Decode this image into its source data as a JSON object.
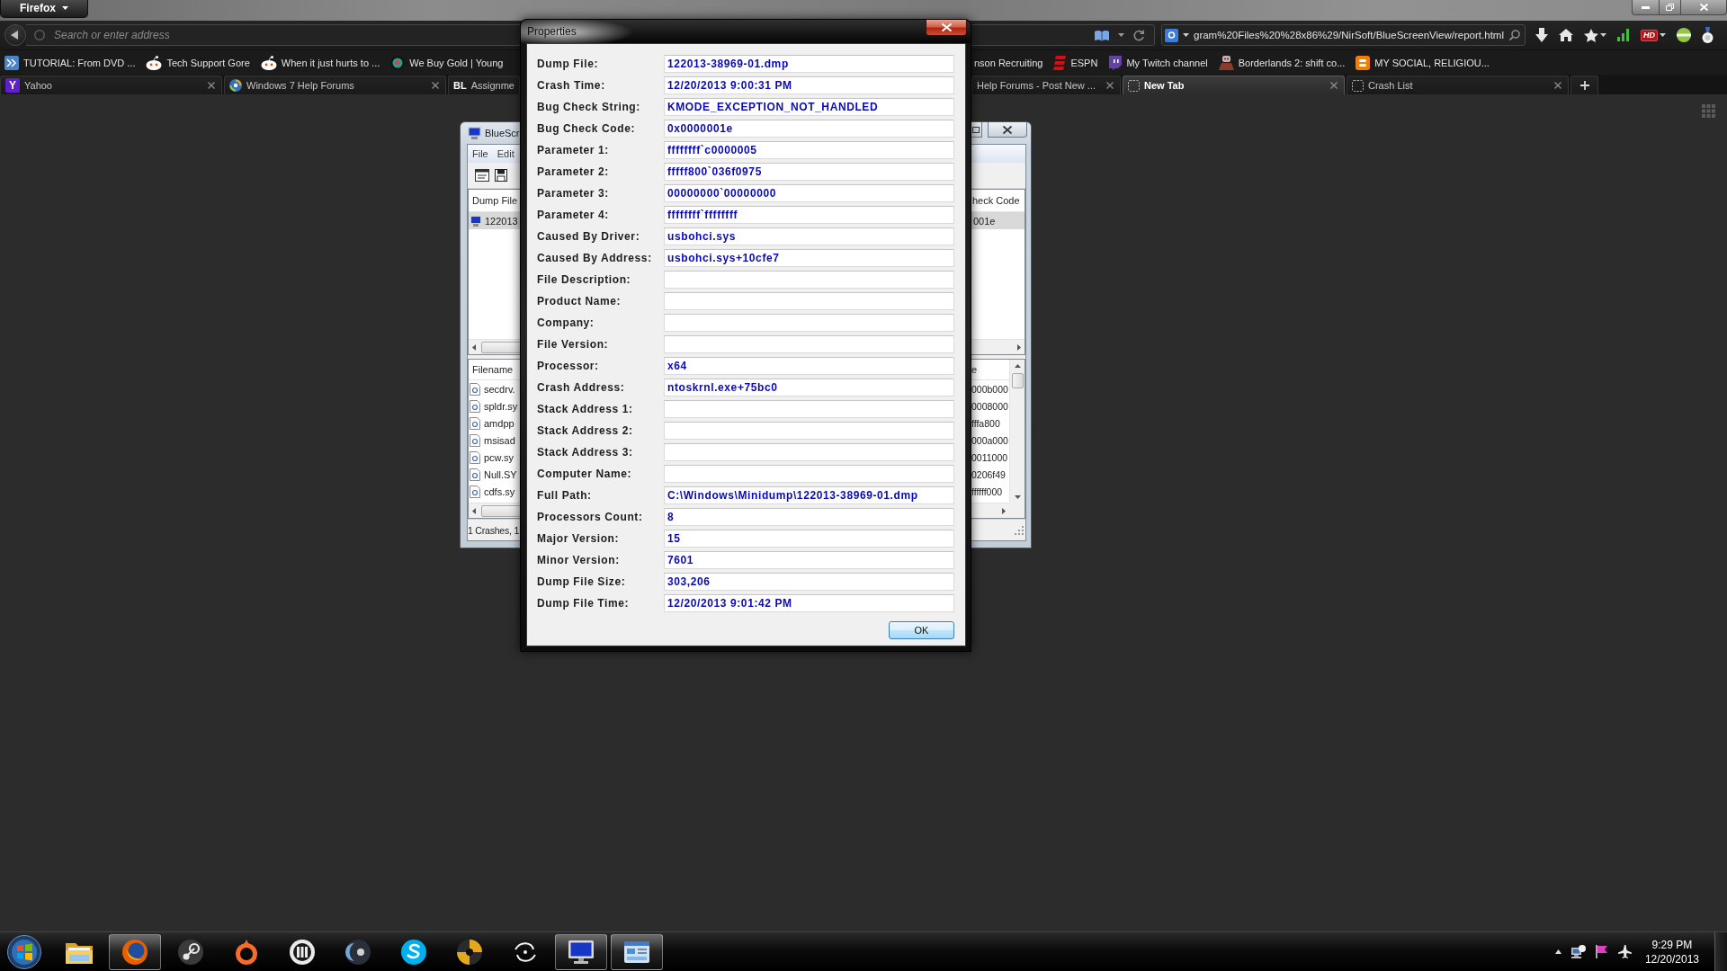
{
  "browser": {
    "menu_button": "Firefox",
    "address_bar": {
      "placeholder": "Search or enter address"
    },
    "search_bar": {
      "value": "gram%20Files%20%28x86%29/NirSoft/BlueScreenView/report.html"
    },
    "hd_badge": "HD",
    "bookmarks_left": [
      {
        "label": "TUTORIAL: From DVD ...",
        "kind": "arrows"
      },
      {
        "label": "Tech Support Gore",
        "kind": "alien"
      },
      {
        "label": "When it just hurts to ...",
        "kind": "alien"
      },
      {
        "label": "We Buy Gold | Young",
        "kind": "emblem"
      }
    ],
    "bookmarks_right": [
      {
        "label": "nson Recruiting"
      },
      {
        "label": "ESPN",
        "kind": "stripes"
      },
      {
        "label": "My Twitch channel",
        "kind": "bubble"
      },
      {
        "label": "Borderlands 2: shift co...",
        "kind": "robot"
      },
      {
        "label": "MY SOCIAL, RELIGIOU...",
        "kind": "square"
      }
    ],
    "tabs_left": [
      {
        "label": "Yahoo",
        "kind": "tile",
        "icon_text": "Y",
        "closable": true,
        "selected": false
      },
      {
        "label": "Windows 7 Help Forums",
        "kind": "swirl",
        "closable": true,
        "selected": false
      },
      {
        "label": "Assignme",
        "kind": "letters",
        "icon_text": "BL",
        "closable": false,
        "selected": false
      }
    ],
    "tabs_right": [
      {
        "label": "Help Forums - Post New ...",
        "closable": true,
        "selected": false
      },
      {
        "label": "New Tab",
        "kind": "blank",
        "closable": true,
        "selected": true
      },
      {
        "label": "Crash List",
        "kind": "blank",
        "closable": true,
        "selected": false
      }
    ]
  },
  "background_window": {
    "title": "BlueScr",
    "menu": [
      "File",
      "Edit"
    ],
    "crash_list": {
      "columns": [
        "Dump File",
        "heck Code"
      ],
      "rows": [
        {
          "cells": [
            "122013",
            "001e"
          ],
          "selected": true
        }
      ]
    },
    "driver_list": {
      "columns": [
        "Filename",
        "e"
      ],
      "rows": [
        {
          "cells": [
            "secdrv.",
            "000b000"
          ]
        },
        {
          "cells": [
            "spldr.sy",
            "0008000"
          ]
        },
        {
          "cells": [
            "amdpp",
            "fffa800"
          ]
        },
        {
          "cells": [
            "msisad",
            "000a000"
          ]
        },
        {
          "cells": [
            "pcw.sy",
            "0011000"
          ]
        },
        {
          "cells": [
            "Null.SY",
            "0206f49"
          ]
        },
        {
          "cells": [
            "cdfs.sy",
            "ffffff000"
          ]
        }
      ]
    },
    "status": "1 Crashes, 1"
  },
  "dialog": {
    "title": "Properties",
    "fields": [
      {
        "label": "Dump File:",
        "value": "122013-38969-01.dmp"
      },
      {
        "label": "Crash Time:",
        "value": "12/20/2013 9:00:31 PM"
      },
      {
        "label": "Bug Check String:",
        "value": "KMODE_EXCEPTION_NOT_HANDLED"
      },
      {
        "label": "Bug Check Code:",
        "value": "0x0000001e"
      },
      {
        "label": "Parameter 1:",
        "value": "ffffffff`c0000005"
      },
      {
        "label": "Parameter 2:",
        "value": "fffff800`036f0975"
      },
      {
        "label": "Parameter 3:",
        "value": "00000000`00000000"
      },
      {
        "label": "Parameter 4:",
        "value": "ffffffff`ffffffff"
      },
      {
        "label": "Caused By Driver:",
        "value": "usbohci.sys"
      },
      {
        "label": "Caused By Address:",
        "value": "usbohci.sys+10cfe7"
      },
      {
        "label": "File Description:"
      },
      {
        "label": "Product Name:"
      },
      {
        "label": "Company:"
      },
      {
        "label": "File Version:"
      },
      {
        "label": "Processor:",
        "value": "x64"
      },
      {
        "label": "Crash Address:",
        "value": "ntoskrnl.exe+75bc0"
      },
      {
        "label": "Stack Address 1:"
      },
      {
        "label": "Stack Address 2:"
      },
      {
        "label": "Stack Address 3:"
      },
      {
        "label": "Computer Name:"
      },
      {
        "label": "Full Path:",
        "value": "C:\\Windows\\Minidump\\122013-38969-01.dmp"
      },
      {
        "label": "Processors Count:",
        "value": "8"
      },
      {
        "label": "Major Version:",
        "value": "15"
      },
      {
        "label": "Minor Version:",
        "value": "7601"
      },
      {
        "label": "Dump File Size:",
        "value": "303,206"
      },
      {
        "label": "Dump File Time:",
        "value": "12/20/2013 9:01:42 PM"
      }
    ],
    "ok_button": "OK"
  },
  "taskbar": {
    "buttons": [
      {
        "kind": "folder",
        "active": false
      },
      {
        "kind": "fox",
        "active": true
      },
      {
        "kind": "knob",
        "active": false
      },
      {
        "kind": "ring",
        "active": false
      },
      {
        "kind": "badge",
        "active": false
      },
      {
        "kind": "crescent",
        "active": false
      },
      {
        "kind": "wave",
        "active": false
      },
      {
        "kind": "disc",
        "active": false
      },
      {
        "kind": "swirl",
        "active": false
      },
      {
        "kind": "monitor",
        "active": true
      },
      {
        "kind": "panel",
        "active": true
      }
    ],
    "clock": {
      "time": "9:29 PM",
      "date": "12/20/2013"
    }
  }
}
